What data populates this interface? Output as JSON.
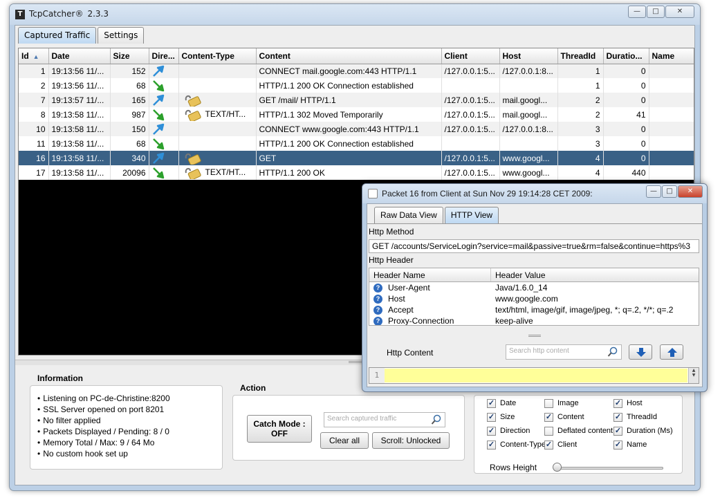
{
  "app": {
    "title": "TcpCatcher®",
    "version": "2.3.3"
  },
  "window_controls": {
    "minimize": "—",
    "maximize": "□",
    "close": "✕"
  },
  "tabs": [
    {
      "label": "Captured Traffic",
      "active": true
    },
    {
      "label": "Settings",
      "active": false
    }
  ],
  "table": {
    "columns": [
      "Id",
      "Date",
      "Size",
      "Dire...",
      "Content-Type",
      "Content",
      "Client",
      "Host",
      "ThreadId",
      "Duratio...",
      "Name"
    ],
    "rows": [
      {
        "id": "1",
        "date": "19:13:56 11/...",
        "size": "152",
        "direction": "out",
        "lock": false,
        "ctype": "",
        "content": "CONNECT mail.google.com:443 HTTP/1.1",
        "client": "/127.0.0.1:5...",
        "host": "/127.0.0.1:8...",
        "thread": "1",
        "duration": "0",
        "name": ""
      },
      {
        "id": "2",
        "date": "19:13:56 11/...",
        "size": "68",
        "direction": "in",
        "lock": false,
        "ctype": "",
        "content": "HTTP/1.1 200 OK Connection established",
        "client": "",
        "host": "",
        "thread": "1",
        "duration": "0",
        "name": ""
      },
      {
        "id": "7",
        "date": "19:13:57 11/...",
        "size": "165",
        "direction": "out",
        "lock": true,
        "ctype": "",
        "content": "GET /mail/ HTTP/1.1",
        "client": "/127.0.0.1:5...",
        "host": "mail.googl...",
        "thread": "2",
        "duration": "0",
        "name": ""
      },
      {
        "id": "8",
        "date": "19:13:58 11/...",
        "size": "987",
        "direction": "in",
        "lock": true,
        "ctype": "TEXT/HT...",
        "content": "HTTP/1.1 302 Moved Temporarily",
        "client": "/127.0.0.1:5...",
        "host": "mail.googl...",
        "thread": "2",
        "duration": "41",
        "name": ""
      },
      {
        "id": "10",
        "date": "19:13:58 11/...",
        "size": "150",
        "direction": "out",
        "lock": false,
        "ctype": "",
        "content": "CONNECT www.google.com:443 HTTP/1.1",
        "client": "/127.0.0.1:5...",
        "host": "/127.0.0.1:8...",
        "thread": "3",
        "duration": "0",
        "name": ""
      },
      {
        "id": "11",
        "date": "19:13:58 11/...",
        "size": "68",
        "direction": "in",
        "lock": false,
        "ctype": "",
        "content": "HTTP/1.1 200 OK Connection established",
        "client": "",
        "host": "",
        "thread": "3",
        "duration": "0",
        "name": ""
      },
      {
        "id": "16",
        "date": "19:13:58 11/...",
        "size": "340",
        "direction": "out",
        "lock": true,
        "ctype": "",
        "content": "GET",
        "client": "/127.0.0.1:5...",
        "host": "www.googl...",
        "thread": "4",
        "duration": "0",
        "name": "",
        "selected": true
      },
      {
        "id": "17",
        "date": "19:13:58 11/...",
        "size": "20096",
        "direction": "in",
        "lock": true,
        "ctype": "TEXT/HT...",
        "content": "HTTP/1.1 200 OK",
        "client": "/127.0.0.1:5...",
        "host": "www.googl...",
        "thread": "4",
        "duration": "440",
        "name": ""
      }
    ]
  },
  "information": {
    "title": "Information",
    "items": [
      "Listening on PC-de-Christine:8200",
      "SSL Server opened on port 8201",
      "No filter applied",
      "Packets Displayed / Pending: 8 / 0",
      "Memory Total / Max: 9 / 64 Mo",
      "No custom hook set up"
    ]
  },
  "action": {
    "title": "Action",
    "catch_mode_line1": "Catch Mode :",
    "catch_mode_line2": "OFF",
    "search_placeholder": "Search captured traffic",
    "clear_all": "Clear all",
    "scroll": "Scroll: Unlocked"
  },
  "columns_panel": {
    "checkboxes": [
      {
        "label": "Date",
        "checked": true
      },
      {
        "label": "Image",
        "checked": false
      },
      {
        "label": "Host",
        "checked": true
      },
      {
        "label": "Size",
        "checked": true
      },
      {
        "label": "Content",
        "checked": true
      },
      {
        "label": "ThreadId",
        "checked": true
      },
      {
        "label": "Direction",
        "checked": true
      },
      {
        "label": "Deflated content",
        "checked": false
      },
      {
        "label": "Duration (Ms)",
        "checked": true
      },
      {
        "label": "Content-Type",
        "checked": true
      },
      {
        "label": "Client",
        "checked": true
      },
      {
        "label": "Name",
        "checked": true
      }
    ],
    "rows_height_label": "Rows Height",
    "rows_height_value": 0
  },
  "popup": {
    "title": "Packet 16 from Client at Sun Nov 29 19:14:28 CET 2009:",
    "tabs": [
      {
        "label": "Raw Data View",
        "active": false
      },
      {
        "label": "HTTP View",
        "active": true
      }
    ],
    "method_label": "Http Method",
    "method_value": "GET /accounts/ServiceLogin?service=mail&passive=true&rm=false&continue=https%3",
    "header_label": "Http Header",
    "header_columns": [
      "Header Name",
      "Header Value"
    ],
    "headers": [
      {
        "name": "User-Agent",
        "value": "Java/1.6.0_14"
      },
      {
        "name": "Host",
        "value": "www.google.com"
      },
      {
        "name": "Accept",
        "value": "text/html, image/gif, image/jpeg, *; q=.2, */*; q=.2"
      },
      {
        "name": "Proxy-Connection",
        "value": "keep-alive"
      }
    ],
    "content_label": "Http Content",
    "content_search_placeholder": "Search http content",
    "line_number": "1"
  },
  "colors": {
    "selected_row": "#3a6186",
    "editor_line": "#ffff99",
    "arrow_out": "#2f8fd8",
    "arrow_in": "#2ca02c"
  }
}
